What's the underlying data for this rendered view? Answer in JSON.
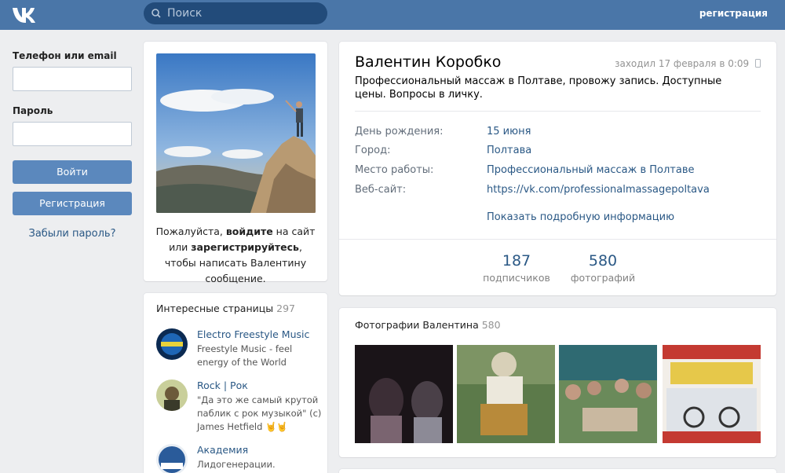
{
  "header": {
    "logo_icon": "vk-logo-icon",
    "search_placeholder": "Поиск",
    "register_link": "регистрация"
  },
  "login": {
    "phone_label": "Телефон или email",
    "password_label": "Пароль",
    "login_button": "Войти",
    "register_button": "Регистрация",
    "forgot_link": "Забыли пароль?"
  },
  "avatar_card": {
    "text_prefix": "Пожалуйста, ",
    "text_login": "войдите",
    "text_middle": " на сайт или ",
    "text_register": "зарегистрируйтесь",
    "text_suffix": ", чтобы написать Валентину сообщение."
  },
  "pages": {
    "title": "Интересные страницы",
    "count": "297",
    "items": [
      {
        "name": "Electro Freestyle Music",
        "desc": "Freestyle Music - feel energy of the World"
      },
      {
        "name": "Rock | Рок",
        "desc": "\"Да это же самый крутой паблик с рок музыкой\" (c) James Hetfield 🤘🤘"
      },
      {
        "name": "Академия",
        "desc": "Лидогенерации."
      }
    ]
  },
  "profile": {
    "name": "Валентин Коробко",
    "last_seen": "заходил 17 февраля в 0:09",
    "status": "Профессиональный массаж в Полтаве, провожу запись. Доступные цены. Вопросы в личку.",
    "info": [
      {
        "label": "День рождения:",
        "value": "15 июня"
      },
      {
        "label": "Город:",
        "value": "Полтава"
      },
      {
        "label": "Место работы:",
        "value": "Профессиональный массаж в Полтаве"
      },
      {
        "label": "Веб-сайт:",
        "value": "https://vk.com/professionalmassagepoltava"
      }
    ],
    "show_more": "Показать подробную информацию",
    "counters": [
      {
        "number": "187",
        "label": "подписчиков"
      },
      {
        "number": "580",
        "label": "фотографий"
      }
    ]
  },
  "photos": {
    "title": "Фотографии Валентина",
    "count": "580"
  },
  "colors": {
    "header": "#4a76a8",
    "link": "#2a5885",
    "button": "#5b88bd",
    "background": "#edeef0"
  }
}
